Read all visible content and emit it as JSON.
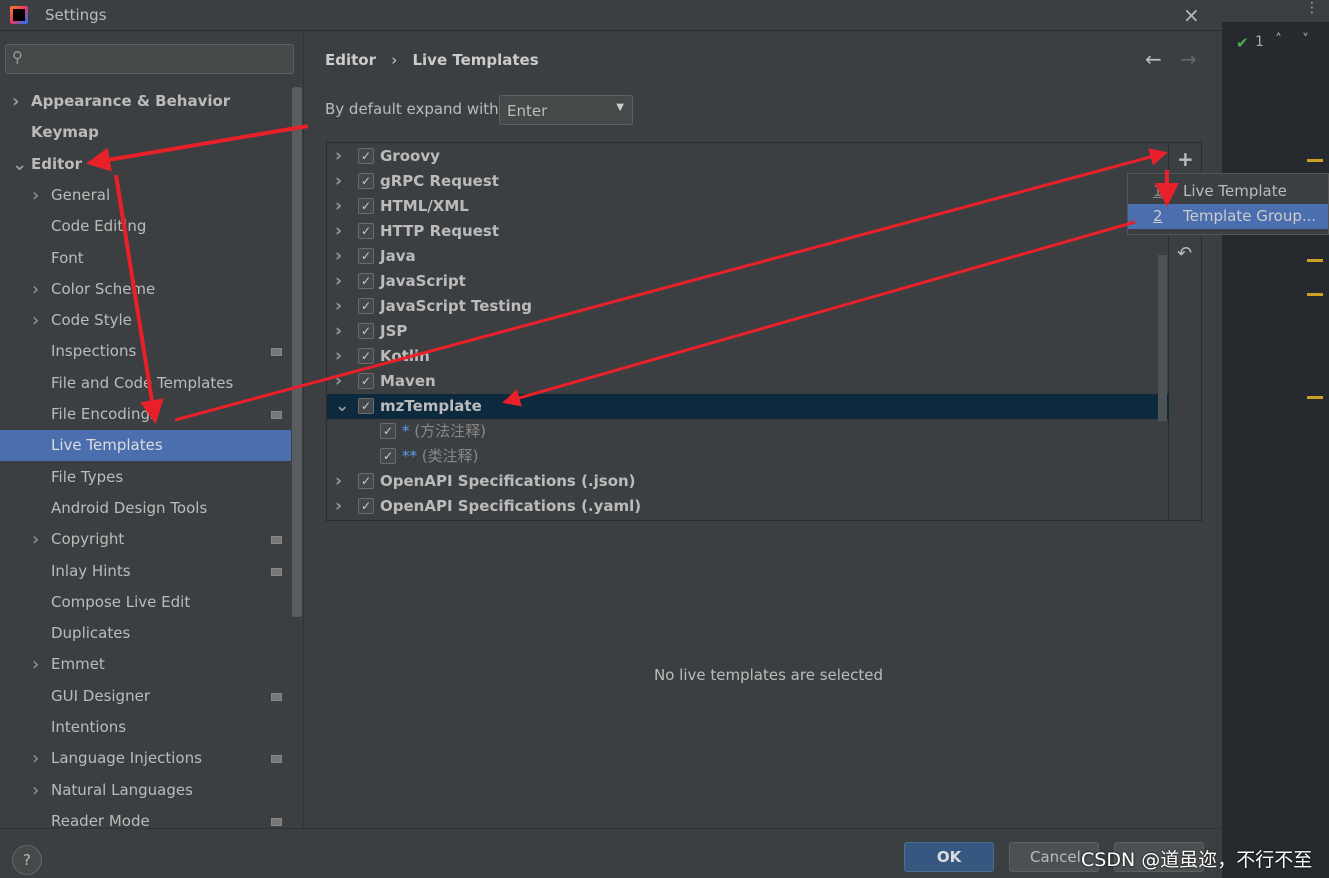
{
  "window": {
    "title": "Settings",
    "close_icon": "×"
  },
  "sidebar": {
    "search_placeholder": "",
    "items": [
      {
        "label": "Appearance & Behavior",
        "level": 0,
        "expandable": true,
        "bold": true
      },
      {
        "label": "Keymap",
        "level": 0,
        "bold": true
      },
      {
        "label": "Editor",
        "level": 0,
        "expanded": true,
        "bold": true
      },
      {
        "label": "General",
        "level": 1,
        "expandable": true
      },
      {
        "label": "Code Editing",
        "level": 1
      },
      {
        "label": "Font",
        "level": 1
      },
      {
        "label": "Color Scheme",
        "level": 1,
        "expandable": true
      },
      {
        "label": "Code Style",
        "level": 1,
        "expandable": true
      },
      {
        "label": "Inspections",
        "level": 1,
        "project": true
      },
      {
        "label": "File and Code Templates",
        "level": 1
      },
      {
        "label": "File Encodings",
        "level": 1,
        "project": true
      },
      {
        "label": "Live Templates",
        "level": 1,
        "selected": true
      },
      {
        "label": "File Types",
        "level": 1
      },
      {
        "label": "Android Design Tools",
        "level": 1
      },
      {
        "label": "Copyright",
        "level": 1,
        "expandable": true,
        "project": true
      },
      {
        "label": "Inlay Hints",
        "level": 1,
        "project": true
      },
      {
        "label": "Compose Live Edit",
        "level": 1
      },
      {
        "label": "Duplicates",
        "level": 1
      },
      {
        "label": "Emmet",
        "level": 1,
        "expandable": true
      },
      {
        "label": "GUI Designer",
        "level": 1,
        "project": true
      },
      {
        "label": "Intentions",
        "level": 1
      },
      {
        "label": "Language Injections",
        "level": 1,
        "expandable": true,
        "project": true
      },
      {
        "label": "Natural Languages",
        "level": 1,
        "expandable": true
      },
      {
        "label": "Reader Mode",
        "level": 1,
        "project": true
      }
    ]
  },
  "breadcrumb": {
    "parent": "Editor",
    "separator": "›",
    "current": "Live Templates"
  },
  "expand": {
    "label": "By default expand with",
    "value": "Enter"
  },
  "templates": [
    {
      "label": "Groovy",
      "checked": true
    },
    {
      "label": "gRPC Request",
      "checked": true
    },
    {
      "label": "HTML/XML",
      "checked": true
    },
    {
      "label": "HTTP Request",
      "checked": true
    },
    {
      "label": "Java",
      "checked": true
    },
    {
      "label": "JavaScript",
      "checked": true
    },
    {
      "label": "JavaScript Testing",
      "checked": true
    },
    {
      "label": "JSP",
      "checked": true
    },
    {
      "label": "Kotlin",
      "checked": true
    },
    {
      "label": "Maven",
      "checked": true
    },
    {
      "label": "mzTemplate",
      "checked": true,
      "expanded": true,
      "selected": true
    },
    {
      "abbr": "*",
      "desc": "(方法注释)",
      "checked": true,
      "child": true
    },
    {
      "abbr": "**",
      "desc": "(类注释)",
      "checked": true,
      "child": true
    },
    {
      "label": "OpenAPI Specifications (.json)",
      "checked": true
    },
    {
      "label": "OpenAPI Specifications (.yaml)",
      "checked": true
    }
  ],
  "popup": {
    "items": [
      {
        "num": "1",
        "label": "Live Template"
      },
      {
        "num": "2",
        "label": "Template Group...",
        "selected": true
      }
    ]
  },
  "empty_text": "No live templates are selected",
  "buttons": {
    "ok": "OK",
    "cancel": "Cancel",
    "help": "?"
  },
  "editor_status": {
    "count": "1"
  },
  "watermark": "CSDN @道虽迩，不行不至",
  "colors": {
    "selection": "#4b6eaf",
    "annotation_arrow": "#e8202a",
    "accent_row": "#0d293e"
  }
}
